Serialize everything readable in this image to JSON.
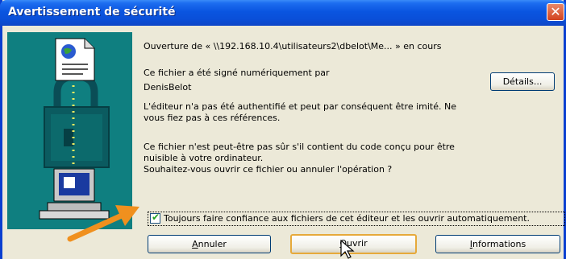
{
  "window": {
    "title": "Avertissement de sécurité",
    "close_symbol": "✕"
  },
  "dialog": {
    "opening_line": "Ouverture de « \\\\192.168.10.4\\utilisateurs2\\dbelot\\Me... » en cours",
    "signed_line1": "Ce fichier a été signé numériquement par",
    "signed_line2": "DenisBelot",
    "publisher_warning_line1": "L'éditeur n'a pas été authentifié et peut par conséquent être imité. Ne",
    "publisher_warning_line2": "vous fiez pas à ces références.",
    "danger_line1": "Ce fichier n'est peut-être pas sûr s'il contient du code conçu pour être",
    "danger_line2": "nuisible à votre ordinateur.",
    "danger_line3": "Souhaitez-vous ouvrir ce fichier ou annuler l'opération ?",
    "always_trust_label": "Toujours faire confiance aux fichiers de cet éditeur et les ouvrir automatiquement.",
    "always_trust_checked": true
  },
  "buttons": {
    "details": {
      "label": "Détails..."
    },
    "cancel": {
      "first": "A",
      "rest": "nnuler"
    },
    "open": {
      "first": "O",
      "rest": "uvrir"
    },
    "info": {
      "first": "I",
      "rest": "nformations"
    }
  },
  "icons": {
    "document": "document-icon",
    "padlock": "padlock-icon",
    "computer": "computer-icon",
    "arrow": "orange-arrow-icon",
    "cursor": "mouse-cursor-icon"
  },
  "colors": {
    "title_bar": "#0a55e0",
    "close_button": "#d2421e",
    "left_panel": "#0f7f80",
    "arrow": "#f0901e",
    "default_button_border": "#e6a93a",
    "dialog_bg": "#ece9d8"
  }
}
